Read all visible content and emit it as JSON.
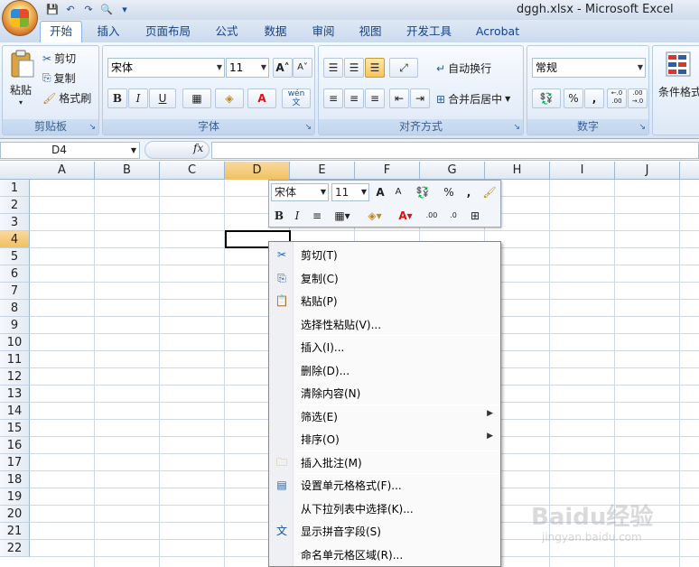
{
  "window": {
    "title": "dggh.xlsx - Microsoft Excel"
  },
  "qat": {
    "save": "💾",
    "undo": "↶",
    "redo": "↷",
    "preview": "🔍",
    "more": "▾"
  },
  "tabs": [
    "开始",
    "插入",
    "页面布局",
    "公式",
    "数据",
    "审阅",
    "视图",
    "开发工具",
    "Acrobat"
  ],
  "clipboard": {
    "paste": "粘贴",
    "cut": "剪切",
    "copy": "复制",
    "format_painter": "格式刷",
    "label": "剪贴板"
  },
  "font": {
    "name": "宋体",
    "size": "11",
    "grow": "A",
    "shrink": "A",
    "bold": "B",
    "italic": "I",
    "underline": "U",
    "font_color": "A",
    "phonetic": "wén\n文",
    "label": "字体"
  },
  "alignment": {
    "wrap": "自动换行",
    "merge": "合并后居中",
    "label": "对齐方式"
  },
  "number": {
    "format": "常规",
    "percent": "%",
    "comma": ",",
    "inc": "←.0\n.00",
    "dec": ".00\n→.0",
    "label": "数字"
  },
  "styles": {
    "conditional": "条件格式"
  },
  "formula_bar": {
    "name_box": "D4",
    "fx": "fx",
    "content": ""
  },
  "columns": [
    "A",
    "B",
    "C",
    "D",
    "E",
    "F",
    "G",
    "H",
    "I",
    "J"
  ],
  "rows": [
    "1",
    "2",
    "3",
    "4",
    "5",
    "6",
    "7",
    "8",
    "9",
    "10",
    "11",
    "12",
    "13",
    "14",
    "15",
    "16",
    "17",
    "18",
    "19",
    "20",
    "21",
    "22"
  ],
  "selected": {
    "column": "D",
    "row": "4"
  },
  "mini_toolbar": {
    "font": "宋体",
    "size": "11",
    "grow": "A",
    "shrink": "A",
    "percent": "%",
    "comma": ",",
    "bold": "B",
    "italic": "I",
    "font_color": "A"
  },
  "context_menu": {
    "items": [
      {
        "label": "剪切(T)",
        "icon": "scissors-icon"
      },
      {
        "label": "复制(C)",
        "icon": "copy-icon"
      },
      {
        "label": "粘贴(P)",
        "icon": "paste-icon"
      },
      {
        "label": "选择性粘贴(V)...",
        "icon": ""
      },
      {
        "label": "插入(I)...",
        "icon": ""
      },
      {
        "label": "删除(D)...",
        "icon": ""
      },
      {
        "label": "清除内容(N)",
        "icon": ""
      },
      {
        "label": "筛选(E)",
        "icon": "",
        "submenu": true
      },
      {
        "label": "排序(O)",
        "icon": "",
        "submenu": true
      },
      {
        "label": "插入批注(M)",
        "icon": "comment-icon"
      },
      {
        "label": "设置单元格格式(F)...",
        "icon": "format-cells-icon"
      },
      {
        "label": "从下拉列表中选择(K)...",
        "icon": ""
      },
      {
        "label": "显示拼音字段(S)",
        "icon": "phonetic-icon"
      },
      {
        "label": "命名单元格区域(R)...",
        "icon": ""
      }
    ]
  },
  "watermark": {
    "main": "Baidu经验",
    "sub": "jingyan.baidu.com"
  }
}
